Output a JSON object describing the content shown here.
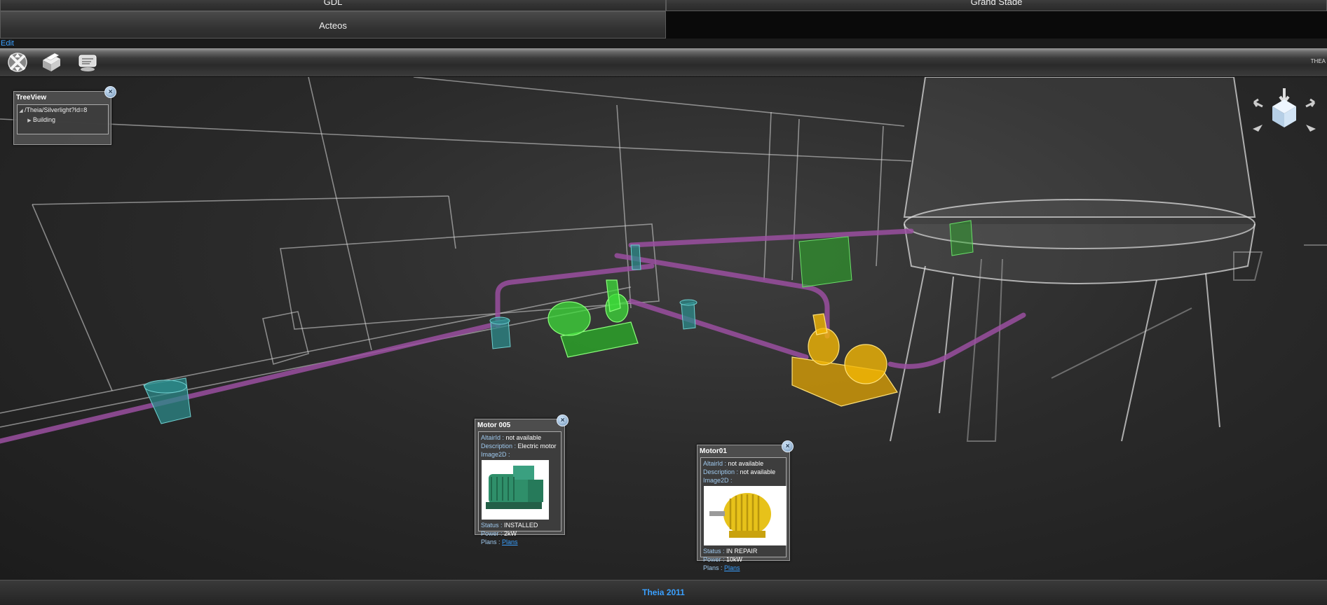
{
  "tabs": {
    "gdl": "GDL",
    "grand_stade": "Grand Stade",
    "acteos": "Acteos"
  },
  "edit_link": "Edit",
  "toolbar": {
    "tools": [
      "navigate-icon",
      "object-icon",
      "info-icon"
    ],
    "right_label": "THEA"
  },
  "treeview": {
    "title": "TreeView",
    "root": "/Theia/Silverlight?Id=8",
    "child": "Building"
  },
  "popups": {
    "motor005": {
      "title": "Motor 005",
      "altair_label": "AltairId",
      "altair_value": "not available",
      "desc_label": "Description",
      "desc_value": "Electric motor",
      "image_label": "Image2D",
      "status_label": "Status",
      "status_value": "INSTALLED",
      "power_label": "Power",
      "power_value": "2kW",
      "plans_label": "Plans",
      "plans_link": "Plans",
      "motor_color": "#2f8f6a"
    },
    "motor01": {
      "title": "Motor01",
      "altair_label": "AltairId",
      "altair_value": "not available",
      "desc_label": "Description",
      "desc_value": "not available",
      "image_label": "Image2D",
      "status_label": "Status",
      "status_value": "IN REPAIR",
      "power_label": "Power",
      "power_value": "10kW",
      "plans_label": "Plans",
      "plans_link": "Plans",
      "motor_color": "#e7c21a"
    }
  },
  "footer": "Theia 2011",
  "colors": {
    "accent": "#3aa0ff",
    "pipe": "#9a4fa0",
    "motor_green": "#3ddc3a",
    "motor_yellow": "#f2b705",
    "tank_teal": "#2c8a8a"
  }
}
